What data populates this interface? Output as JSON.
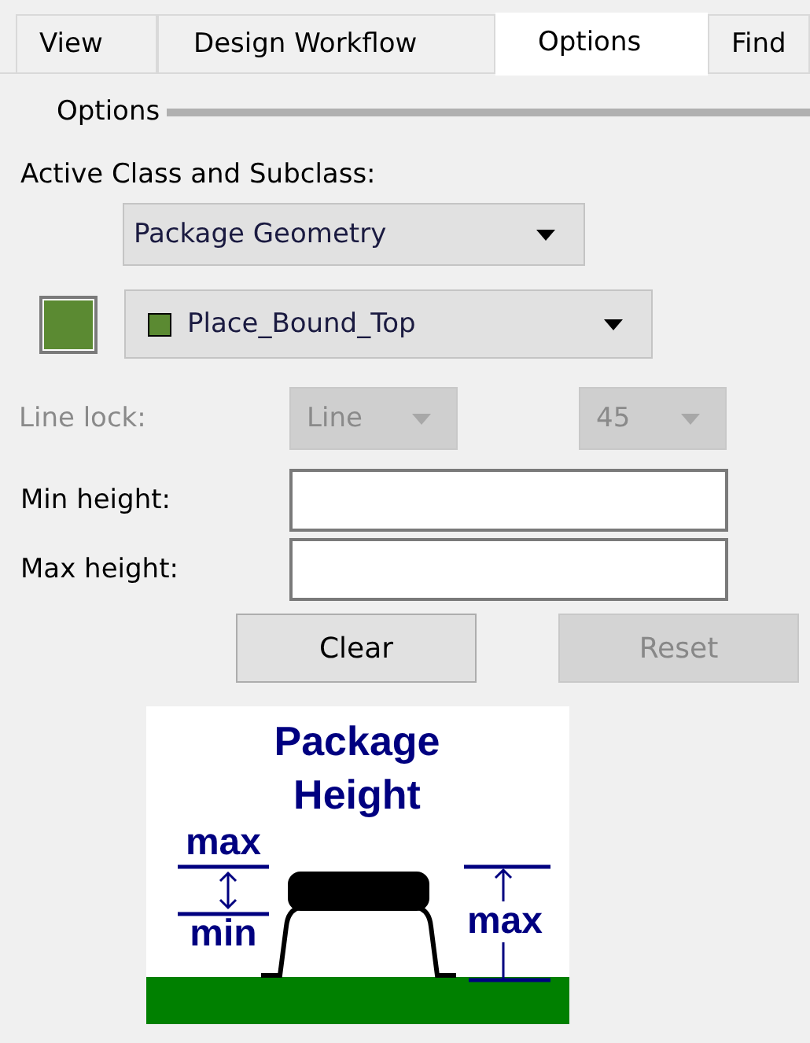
{
  "tabs": [
    {
      "label": "View",
      "selected": false
    },
    {
      "label": "Design Workflow",
      "selected": false
    },
    {
      "label": "Options",
      "selected": true
    },
    {
      "label": "Find",
      "selected": false
    }
  ],
  "section": {
    "title": "Options"
  },
  "active_class": {
    "label": "Active Class and Subclass:",
    "class_value": "Package Geometry",
    "subclass_value": "Place_Bound_Top",
    "color": "#5b8a32"
  },
  "line_lock": {
    "label": "Line lock:",
    "disabled": true,
    "mode": "Line",
    "angle": "45"
  },
  "fields": [
    {
      "label": "Min height:"
    },
    {
      "label": "Max height:"
    }
  ],
  "buttons": [
    {
      "label": "Clear",
      "disabled": false
    },
    {
      "label": "Reset",
      "disabled": true
    }
  ],
  "diagram": {
    "title_lines": [
      "Package",
      "Height"
    ],
    "left_top": "max",
    "left_bottom": "min",
    "right": "max"
  }
}
